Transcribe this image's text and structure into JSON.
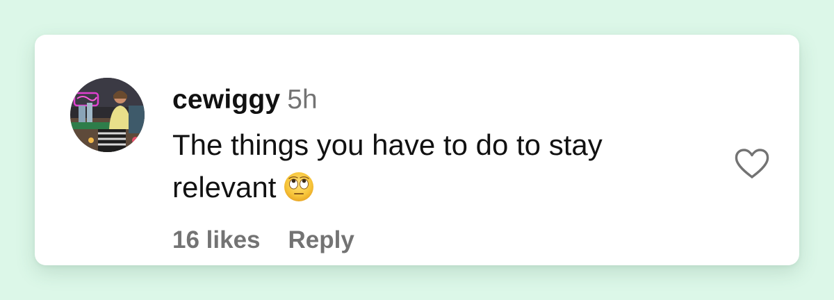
{
  "comment": {
    "username": "cewiggy",
    "timestamp": "5h",
    "text": "The things you have to do to stay relevant",
    "emoji": "face-with-rolling-eyes",
    "likes_label": "16 likes",
    "reply_label": "Reply",
    "like_icon": "heart-outline-icon"
  },
  "colors": {
    "page_background": "#dcf7e8",
    "card_background": "#ffffff",
    "primary_text": "#111111",
    "secondary_text": "#737373"
  }
}
